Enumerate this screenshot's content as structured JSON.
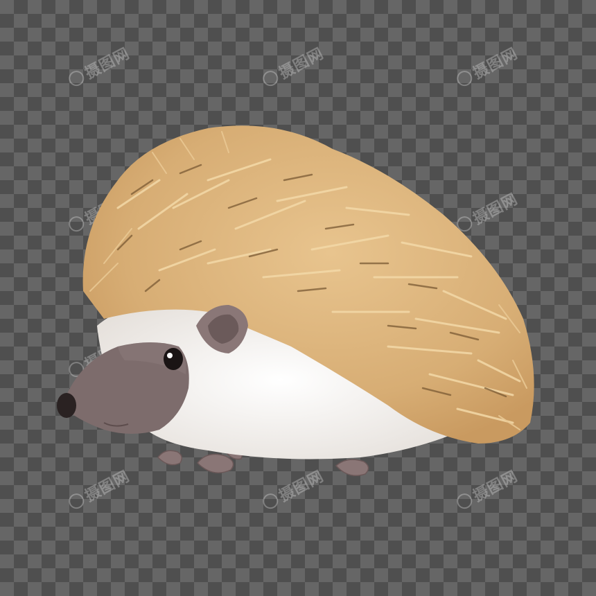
{
  "watermark": {
    "text": "摄图网",
    "copies": 9
  },
  "subject": {
    "icon": "hedgehog-illustration",
    "colors": {
      "spines": "#d9b27c",
      "spines_light": "#eecf9c",
      "spines_dark": "#7a5a34",
      "fur": "#f1efed",
      "face": "#7d6c6c",
      "nose": "#2a2222",
      "feet": "#8a7676"
    }
  }
}
